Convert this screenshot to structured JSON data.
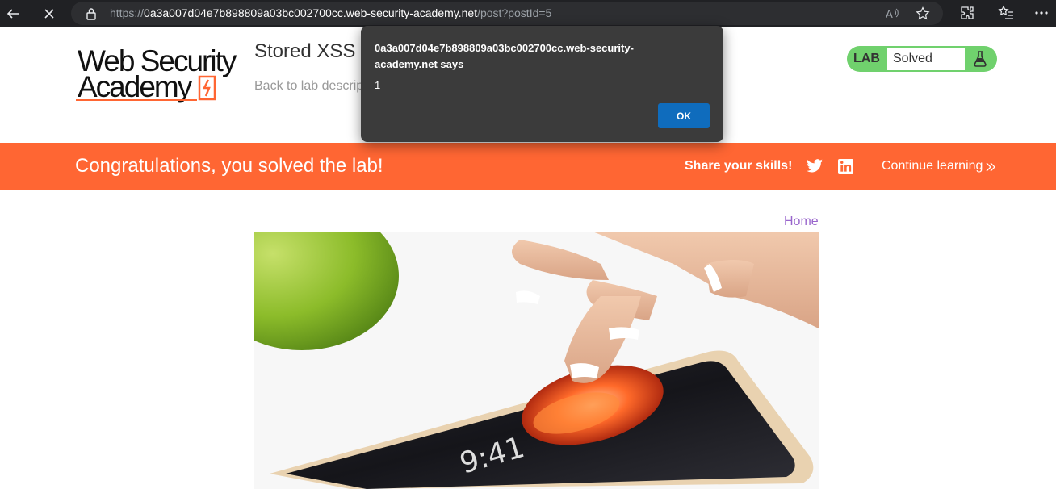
{
  "browser": {
    "url_scheme": "https://",
    "url_host": "0a3a007d04e7b898809a03bc002700cc.web-security-academy.net",
    "url_path": "/post?postId=5"
  },
  "header": {
    "logo_line1": "Web Security",
    "logo_line2": "Academy",
    "lab_title": "Stored XSS",
    "back_link": "Back to lab descrip",
    "lab_badge": "LAB",
    "lab_status": "Solved"
  },
  "banner": {
    "message": "Congratulations, you solved the lab!",
    "share_label": "Share your skills!",
    "continue_label": "Continue learning"
  },
  "nav": {
    "home_label": "Home"
  },
  "alert": {
    "origin_text": "0a3a007d04e7b898809a03bc002700cc.web-security-academy.net says",
    "message": "1",
    "ok_label": "OK"
  },
  "colors": {
    "accent_orange": "#ff6633",
    "lab_green": "#70d16d",
    "link_purple": "#9966cc",
    "dialog_button": "#0f6cbd"
  },
  "icons": [
    "back-arrow-icon",
    "stop-icon",
    "lock-icon",
    "read-aloud-icon",
    "favorite-star-icon",
    "extensions-icon",
    "favorites-icon",
    "more-icon",
    "flask-icon",
    "twitter-icon",
    "linkedin-icon",
    "chevron-right-double-icon"
  ]
}
